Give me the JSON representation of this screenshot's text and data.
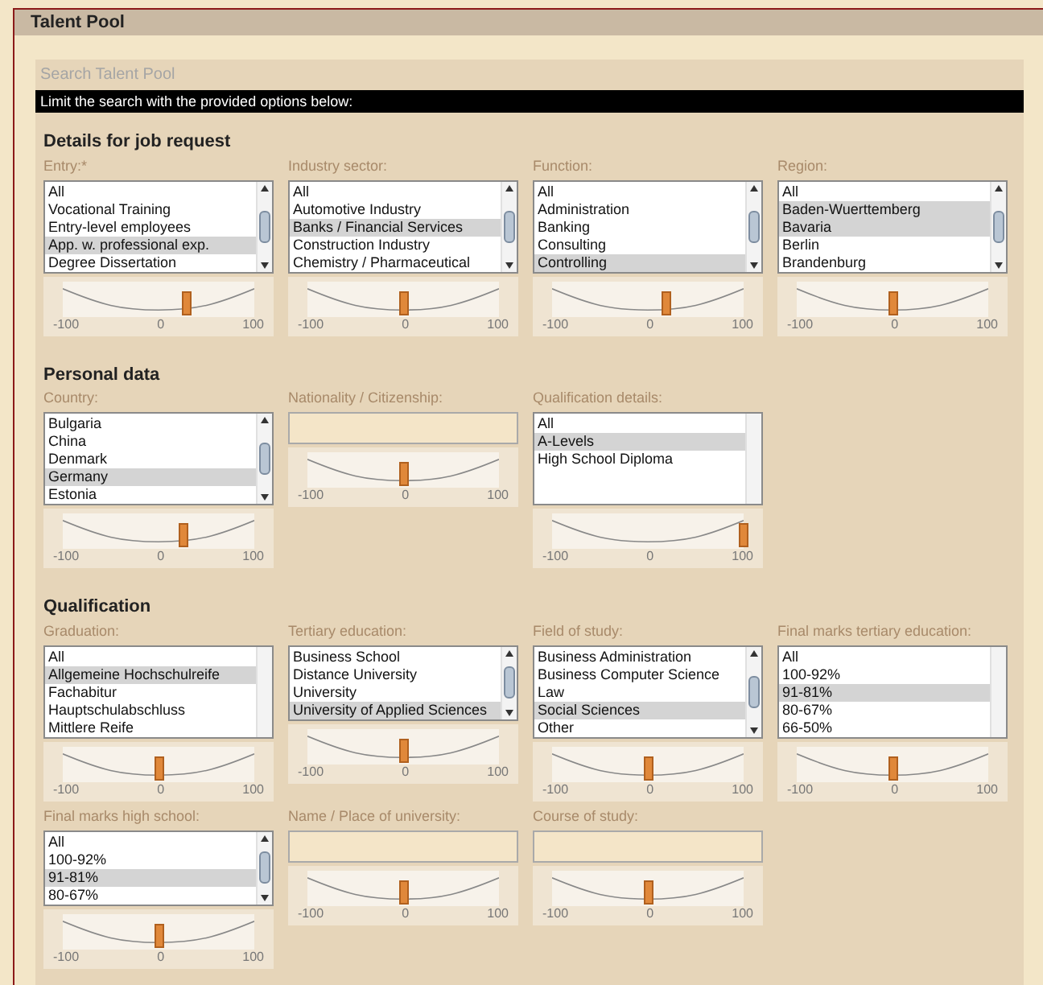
{
  "window": {
    "title": "Talent Pool"
  },
  "panel": {
    "title": "Search Talent Pool",
    "instruction": "Limit the search with the provided options below:"
  },
  "sections": [
    {
      "heading": "Details for job request",
      "fields": [
        {
          "label": "Entry:*",
          "kind": "list",
          "scrollable": true,
          "items": [
            {
              "text": "All",
              "selected": false
            },
            {
              "text": "Vocational Training",
              "selected": false
            },
            {
              "text": "Entry-level employees",
              "selected": false
            },
            {
              "text": "App. w. professional exp.",
              "selected": true
            },
            {
              "text": "Degree Dissertation",
              "selected": false
            }
          ],
          "slider": {
            "level": 0.65,
            "ticks": [
              "-100",
              "0",
              "100"
            ]
          }
        },
        {
          "label": "Industry sector:",
          "kind": "list",
          "scrollable": true,
          "items": [
            {
              "text": "All",
              "selected": false
            },
            {
              "text": "Automotive Industry",
              "selected": false
            },
            {
              "text": "Banks / Financial Services",
              "selected": true
            },
            {
              "text": "Construction Industry",
              "selected": false
            },
            {
              "text": "Chemistry / Pharmaceutical",
              "selected": false
            }
          ],
          "slider": {
            "level": 0.5,
            "ticks": [
              "-100",
              "0",
              "100"
            ]
          }
        },
        {
          "label": "Function:",
          "kind": "list",
          "scrollable": true,
          "items": [
            {
              "text": "All",
              "selected": false
            },
            {
              "text": "Administration",
              "selected": false
            },
            {
              "text": "Banking",
              "selected": false
            },
            {
              "text": "Consulting",
              "selected": false
            },
            {
              "text": "Controlling",
              "selected": true
            }
          ],
          "slider": {
            "level": 0.6,
            "ticks": [
              "-100",
              "0",
              "100"
            ]
          }
        },
        {
          "label": "Region:",
          "kind": "list",
          "scrollable": true,
          "items": [
            {
              "text": "All",
              "selected": false
            },
            {
              "text": "Baden-Wuerttemberg",
              "selected": true
            },
            {
              "text": "Bavaria",
              "selected": true
            },
            {
              "text": "Berlin",
              "selected": false
            },
            {
              "text": "Brandenburg",
              "selected": false
            }
          ],
          "slider": {
            "level": 0.5,
            "ticks": [
              "-100",
              "0",
              "100"
            ]
          }
        }
      ]
    },
    {
      "heading": "Personal data",
      "fields": [
        {
          "label": "Country:",
          "kind": "list",
          "scrollable": true,
          "items": [
            {
              "text": "Bulgaria",
              "selected": false
            },
            {
              "text": "China",
              "selected": false
            },
            {
              "text": "Denmark",
              "selected": false
            },
            {
              "text": "Germany",
              "selected": true
            },
            {
              "text": "Estonia",
              "selected": false
            }
          ],
          "slider": {
            "level": 0.63,
            "ticks": [
              "-100",
              "0",
              "100"
            ]
          }
        },
        {
          "label": "Nationality / Citizenship:",
          "kind": "text",
          "slider": {
            "level": 0.5,
            "ticks": [
              "-100",
              "0",
              "100"
            ]
          }
        },
        {
          "label": "Qualification details:",
          "kind": "list",
          "scrollable": false,
          "items": [
            {
              "text": "All",
              "selected": false
            },
            {
              "text": "A-Levels",
              "selected": true
            },
            {
              "text": "High School Diploma",
              "selected": false
            }
          ],
          "slider": {
            "level": 1,
            "ticks": [
              "-100",
              "0",
              "100"
            ]
          }
        }
      ]
    },
    {
      "heading": "Qualification",
      "fields": [
        {
          "label": "Graduation:",
          "kind": "list",
          "scrollable": false,
          "items": [
            {
              "text": "All",
              "selected": false
            },
            {
              "text": "Allgemeine Hochschulreife",
              "selected": true
            },
            {
              "text": "Fachabitur",
              "selected": false
            },
            {
              "text": "Hauptschulabschluss",
              "selected": false
            },
            {
              "text": "Mittlere Reife",
              "selected": false
            }
          ],
          "slider": {
            "level": 0.5,
            "ticks": [
              "-100",
              "0",
              "100"
            ]
          }
        },
        {
          "label": "Tertiary education:",
          "kind": "list",
          "scrollable": true,
          "items": [
            {
              "text": "Business School",
              "selected": false
            },
            {
              "text": "Distance University",
              "selected": false
            },
            {
              "text": "University",
              "selected": false
            },
            {
              "text": "University of Applied Sciences",
              "selected": true
            }
          ],
          "slider": {
            "level": 0.5,
            "ticks": [
              "-100",
              "0",
              "100"
            ]
          }
        },
        {
          "label": "Field of study:",
          "kind": "list",
          "scrollable": true,
          "items": [
            {
              "text": "Business Administration",
              "selected": false
            },
            {
              "text": "Business Computer Science",
              "selected": false
            },
            {
              "text": "Law",
              "selected": false
            },
            {
              "text": "Social Sciences",
              "selected": true
            },
            {
              "text": "Other",
              "selected": false
            }
          ],
          "slider": {
            "level": 0.5,
            "ticks": [
              "-100",
              "0",
              "100"
            ]
          }
        },
        {
          "label": "Final marks tertiary education:",
          "kind": "list",
          "scrollable": false,
          "items": [
            {
              "text": "All",
              "selected": false
            },
            {
              "text": "100-92%",
              "selected": false
            },
            {
              "text": "91-81%",
              "selected": true
            },
            {
              "text": "80-67%",
              "selected": false
            },
            {
              "text": "66-50%",
              "selected": false
            }
          ],
          "slider": {
            "level": 0.5,
            "ticks": [
              "-100",
              "0",
              "100"
            ]
          }
        },
        {
          "label": "Final marks high school:",
          "kind": "list",
          "scrollable": true,
          "items": [
            {
              "text": "All",
              "selected": false
            },
            {
              "text": "100-92%",
              "selected": false
            },
            {
              "text": "91-81%",
              "selected": true
            },
            {
              "text": "80-67%",
              "selected": false
            }
          ],
          "slider": {
            "level": 0.5,
            "ticks": [
              "-100",
              "0",
              "100"
            ]
          }
        },
        {
          "label": "Name / Place of university:",
          "kind": "text",
          "slider": {
            "level": 0.5,
            "ticks": [
              "-100",
              "0",
              "100"
            ]
          }
        },
        {
          "label": "Course of study:",
          "kind": "text",
          "slider": {
            "level": 0.5,
            "ticks": [
              "-100",
              "0",
              "100"
            ]
          }
        }
      ]
    }
  ]
}
